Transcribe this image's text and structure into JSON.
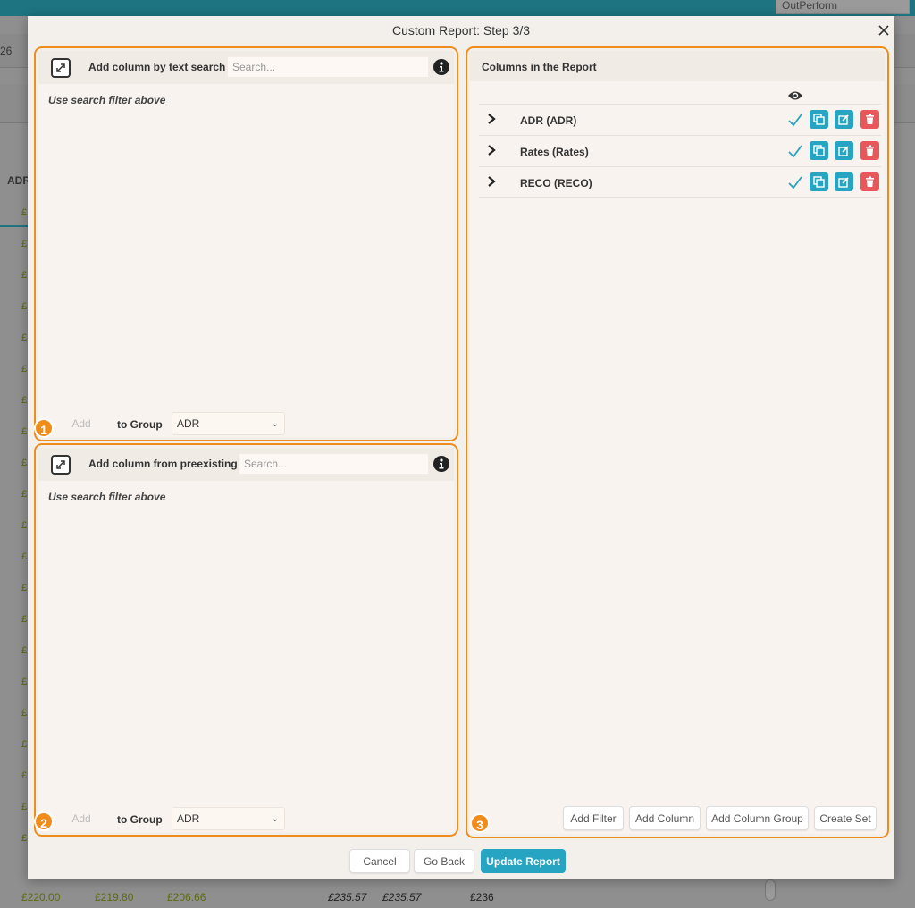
{
  "background": {
    "topbar_field": "OutPerform",
    "row_number": "26",
    "column_header": "ADR",
    "pound_symbol": "£",
    "bottom_values": [
      "£220.00",
      "£219.80",
      "£206.66",
      "£235.57",
      "£235.57",
      "£236"
    ]
  },
  "modal": {
    "title": "Custom Report: Step 3/3",
    "close_icon": "close-icon"
  },
  "text_search_panel": {
    "badge": "1",
    "label": "Add column by text search",
    "search_placeholder": "Search...",
    "hint": "Use search filter above",
    "add_label": "Add",
    "to_group_label": "to Group",
    "group_value": "ADR"
  },
  "preexisting_panel": {
    "badge": "2",
    "label": "Add column from preexisting",
    "search_placeholder": "Search...",
    "hint": "Use search filter above",
    "add_label": "Add",
    "to_group_label": "to Group",
    "group_value": "ADR"
  },
  "columns_panel": {
    "badge": "3",
    "title": "Columns in the Report",
    "visibility_icon": "eye-icon",
    "rows": [
      {
        "label": "ADR (ADR)",
        "visible": true
      },
      {
        "label": "Rates (Rates)",
        "visible": true
      },
      {
        "label": "RECO (RECO)",
        "visible": true
      }
    ],
    "buttons": {
      "add_filter": "Add Filter",
      "add_column": "Add Column",
      "add_column_group": "Add Column Group",
      "create_set": "Create Set"
    }
  },
  "footer": {
    "cancel": "Cancel",
    "go_back": "Go Back",
    "update_report": "Update Report"
  },
  "colors": {
    "accent": "#27a4c2",
    "highlight": "#f08c1c",
    "danger": "#e8585a",
    "topbar": "#1e7480"
  }
}
